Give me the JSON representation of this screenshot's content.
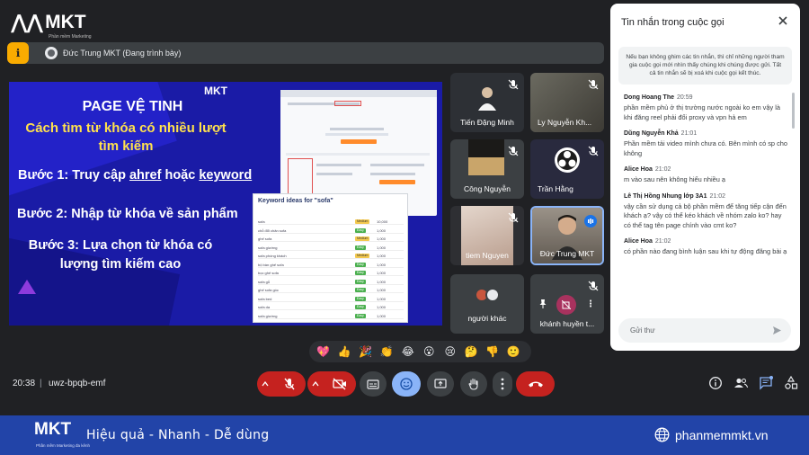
{
  "app": {
    "logo_text": "MKT",
    "logo_tagline": "Phần mềm Marketing",
    "presenter_label": "Đức Trung MKT (Đang trình bày)",
    "present_icon_glyph": "ℹ"
  },
  "slide": {
    "logo": "MKT",
    "title": "PAGE VỆ TINH",
    "subtitle": "Cách tìm từ khóa có nhiều lượt tìm kiếm",
    "step1_prefix": "Bước 1: Truy cập ",
    "step1_link1": "ahref",
    "step1_mid": " hoặc ",
    "step1_link2": "keyword",
    "step2": "Bước 2: Nhập từ khóa về sản phẩm",
    "step3": "Bước 3: Lựa chọn từ khóa có lượng tìm kiếm cao",
    "keyword_panel_title": "Keyword ideas for \"sofa\"",
    "keyword_rows": [
      {
        "kw": "sofa",
        "diff": "Medium",
        "vol": "10,000"
      },
      {
        "kw": "chỗ đổi chân sofa",
        "diff": "Easy",
        "vol": "1,000"
      },
      {
        "kw": "ghế sofa",
        "diff": "Medium",
        "vol": "1,000"
      },
      {
        "kw": "sofa giường",
        "diff": "Easy",
        "vol": "1,000"
      },
      {
        "kw": "sofa phòng khách",
        "diff": "Medium",
        "vol": "1,000"
      },
      {
        "kw": "bộ bàn ghế sofa",
        "diff": "Easy",
        "vol": "1,000"
      },
      {
        "kw": "bọc ghế sofa",
        "diff": "Easy",
        "vol": "1,000"
      },
      {
        "kw": "sofa gỗ",
        "diff": "Easy",
        "vol": "1,000"
      },
      {
        "kw": "ghế sofa góc",
        "diff": "Easy",
        "vol": "1,000"
      },
      {
        "kw": "sofa bed",
        "diff": "Easy",
        "vol": "1,000"
      },
      {
        "kw": "sofa da",
        "diff": "Easy",
        "vol": "1,000"
      },
      {
        "kw": "sofa giường",
        "diff": "Easy",
        "vol": "1,000"
      }
    ]
  },
  "participants": [
    {
      "name": "Tiến Đặng Minh"
    },
    {
      "name": "Ly Nguyễn Kh..."
    },
    {
      "name": "Công Nguyễn"
    },
    {
      "name": "Trần Hằng"
    },
    {
      "name": "tiem Nguyen"
    },
    {
      "name": "Đức Trung MKT"
    },
    {
      "name": "người khác"
    },
    {
      "name": "khánh huyền t..."
    }
  ],
  "chat": {
    "title": "Tin nhắn trong cuộc gọi",
    "notice": "Nếu bạn không ghim các tin nhắn, thì chỉ những người tham gia cuộc gọi mới nhìn thấy chúng khi chúng được gửi. Tất cả tin nhắn sẽ bị xoá khi cuộc gọi kết thúc.",
    "messages": [
      {
        "sender": "Dong Hoang The",
        "time": "20:59",
        "text": "phần mềm phủ ở thị trường nước ngoài ko em vậy là khi đăng reel phải đổi proxy và vpn hả em"
      },
      {
        "sender": "Dũng Nguyễn Khả",
        "time": "21:01",
        "text": "Phần mềm tải video mình chưa có. Bên mình có sp cho không"
      },
      {
        "sender": "Alice Hoa",
        "time": "21:02",
        "text": "m vào sau nên không hiểu nhiều ạ"
      },
      {
        "sender": "Lê Thị Hồng Nhung lớp 3A1",
        "time": "21:02",
        "text": "vậy cần sử dụng cả bộ phần mềm để tăng tiếp cận đến khách ạ? vậy có thể kéo khách về nhóm zalo ko? hay có thể tag tên page chính vào cmt ko?"
      },
      {
        "sender": "Alice Hoa",
        "time": "21:02",
        "text": "có phần nào đang bình luận sau khi tự động đăng bài ạ"
      }
    ],
    "input_placeholder": "Gửi thư"
  },
  "reactions": [
    "💖",
    "👍",
    "🎉",
    "👏",
    "😂",
    "😮",
    "😢",
    "🤔",
    "👎",
    "🙂"
  ],
  "meeting": {
    "time": "20:38",
    "separator": "|",
    "code": "uwz-bpqb-emf"
  },
  "footer": {
    "logo": "MKT",
    "logo_tagline": "Phần mềm Marketing đa kênh",
    "slogan": "Hiệu quả - Nhanh - Dễ dùng",
    "website": "phanmemmkt.vn"
  },
  "colors": {
    "accent_red": "#c5221f",
    "accent_blue": "#8ab4f8",
    "present_yellow": "#f9ab00",
    "slide_blue": "#1a1ba6",
    "footer_blue": "#2244a8"
  }
}
